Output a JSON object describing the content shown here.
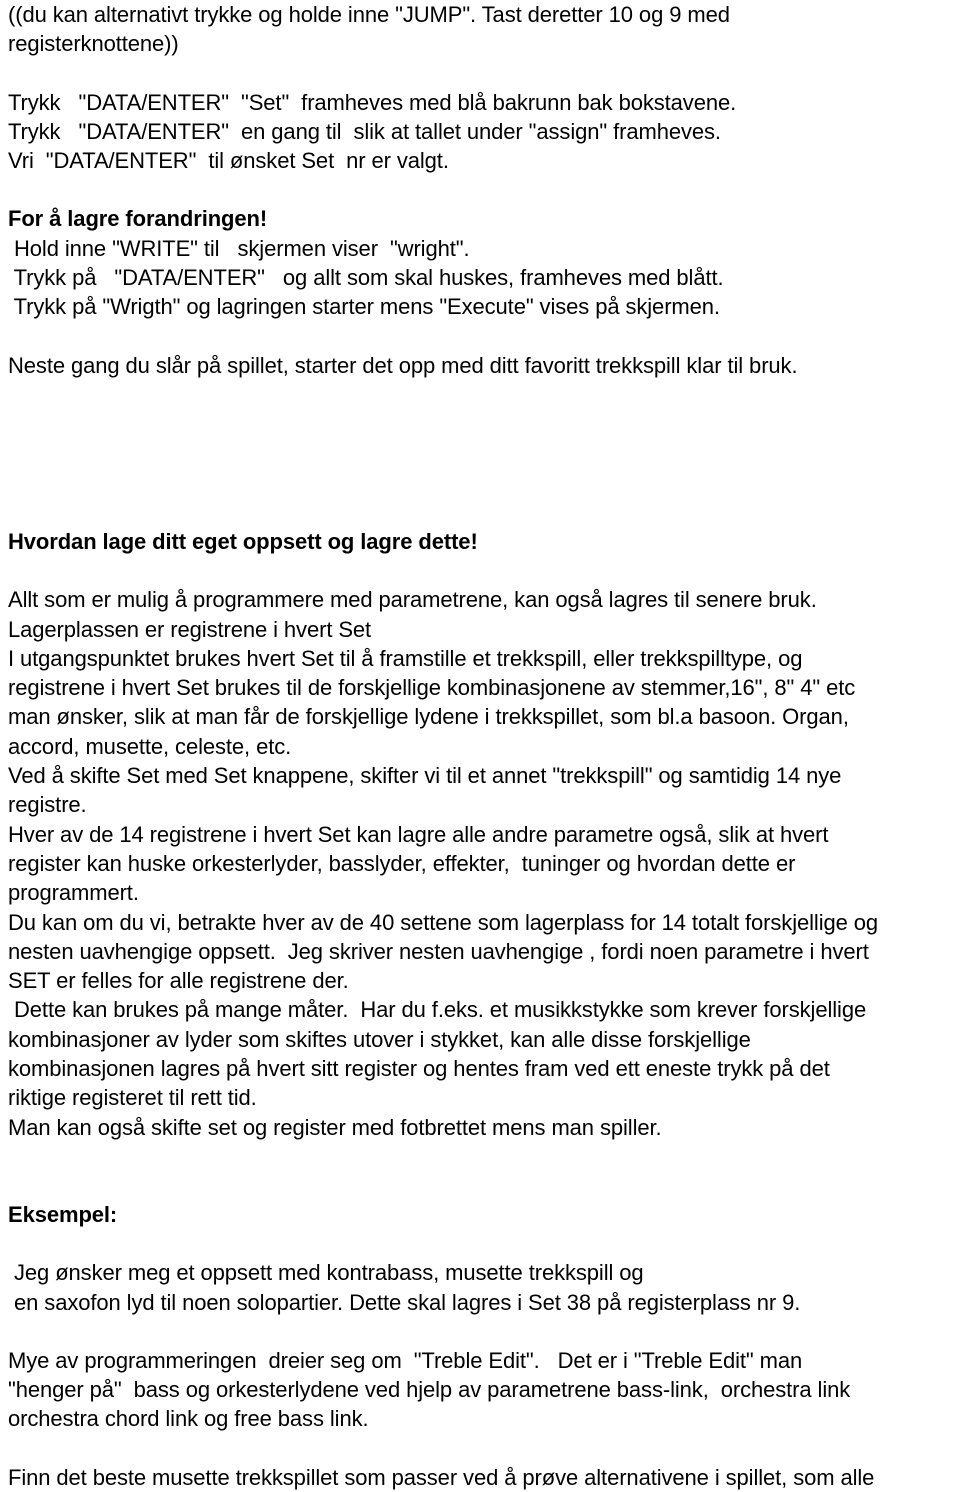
{
  "document": {
    "language": "Norwegian",
    "page_background": "#ffffff",
    "text_color": "#000000",
    "blocks": [
      {
        "id": "intro-parenthetical",
        "type": "paragraph",
        "lines": [
          "((du kan alternativt trykke og holde inne \"JUMP\". Tast deretter 10 og 9 med",
          "registerknottene))"
        ]
      },
      {
        "id": "data-enter-steps",
        "type": "paragraph",
        "lines": [
          "Trykk   \"DATA/ENTER\"  \"Set\"  framheves med blå bakrunn bak bokstavene.",
          "Trykk   \"DATA/ENTER\"  en gang til  slik at tallet under \"assign\" framheves.",
          "Vri  \"DATA/ENTER\"  til ønsket Set  nr er valgt."
        ]
      },
      {
        "id": "save-change-heading",
        "type": "heading",
        "text": "For å lagre forandringen!"
      },
      {
        "id": "save-change-steps",
        "type": "paragraph",
        "lines": [
          " Hold inne \"WRITE\" til   skjermen viser  \"wright\".",
          " Trykk på   \"DATA/ENTER\"   og allt som skal huskes, framheves med blått.",
          " Trykk på \"Wrigth\" og lagringen starter mens \"Execute\" vises på skjermen."
        ]
      },
      {
        "id": "next-time-note",
        "type": "paragraph",
        "lines": [
          "Neste gang du slår på spillet, starter det opp med ditt favoritt trekkspill klar til bruk."
        ]
      },
      {
        "id": "own-setup-heading",
        "type": "heading",
        "text": "Hvordan lage ditt eget oppsett og lagre dette!"
      },
      {
        "id": "own-setup-body",
        "type": "paragraph",
        "lines": [
          "Allt som er mulig å programmere med parametrene, kan også lagres til senere bruk.",
          "Lagerplassen er registrene i hvert Set",
          "I utgangspunktet brukes hvert Set til å framstille et trekkspill, eller trekkspilltype, og",
          "registrene i hvert Set brukes til de forskjellige kombinasjonene av stemmer,16\", 8\" 4\" etc",
          "man ønsker, slik at man får de forskjellige lydene i trekkspillet, som bl.a basoon. Organ,",
          "accord, musette, celeste, etc.",
          "Ved å skifte Set med Set knappene, skifter vi til et annet \"trekkspill\" og samtidig 14 nye",
          "registre.",
          "Hver av de 14 registrene i hvert Set kan lagre alle andre parametre også, slik at hvert",
          "register kan huske orkesterlyder, basslyder, effekter,  tuninger og hvordan dette er",
          "programmert.",
          "Du kan om du vi, betrakte hver av de 40 settene som lagerplass for 14 totalt forskjellige og",
          "nesten uavhengige oppsett.  Jeg skriver nesten uavhengige , fordi noen parametre i hvert",
          "SET er felles for alle registrene der.",
          " Dette kan brukes på mange måter.  Har du f.eks. et musikkstykke som krever forskjellige",
          "kombinasjoner av lyder som skiftes utover i stykket, kan alle disse forskjellige",
          "kombinasjonen lagres på hvert sitt register og hentes fram ved ett eneste trykk på det",
          "riktige registeret til rett tid.",
          "Man kan også skifte set og register med fotbrettet mens man spiller."
        ]
      },
      {
        "id": "example-heading",
        "type": "heading",
        "text": "Eksempel:"
      },
      {
        "id": "example-body",
        "type": "paragraph",
        "lines": [
          " Jeg ønsker meg et oppsett med kontrabass, musette trekkspill og",
          " en saxofon lyd til noen solopartier. Dette skal lagres i Set 38 på registerplass nr 9."
        ]
      },
      {
        "id": "treble-edit-body",
        "type": "paragraph",
        "lines": [
          "Mye av programmeringen  dreier seg om  \"Treble Edit\".   Det er i \"Treble Edit\" man",
          "\"henger på\"  bass og orkesterlydene ved hjelp av parametrene bass-link,  orchestra link",
          "orchestra chord link og free bass link."
        ]
      },
      {
        "id": "find-musette-body",
        "type": "paragraph",
        "lines": [
          "Finn det beste musette trekkspillet som passer ved å prøve alternativene i spillet, som alle"
        ]
      }
    ]
  }
}
